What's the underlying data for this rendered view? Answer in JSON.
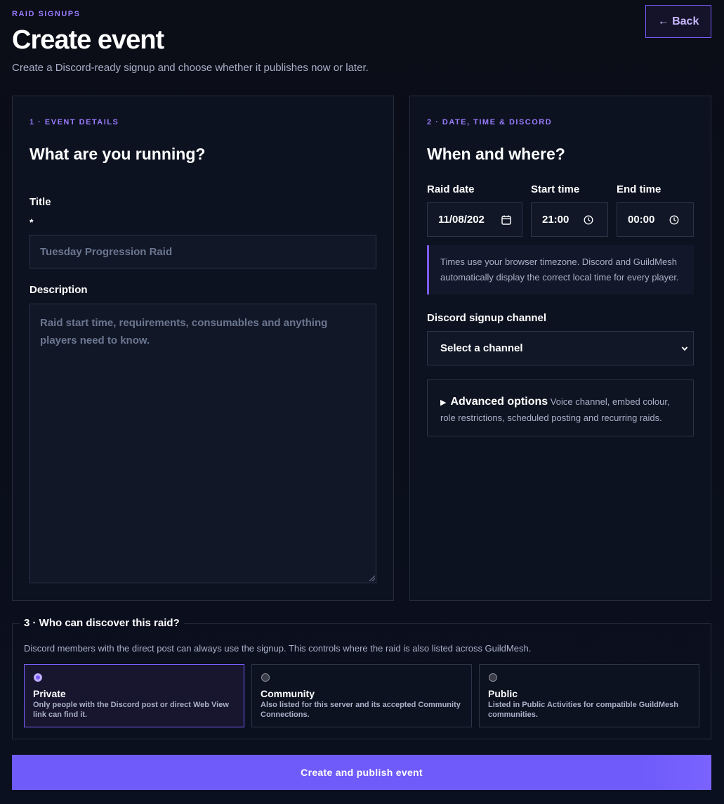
{
  "header": {
    "eyebrow": "RAID SIGNUPS",
    "title": "Create event",
    "subtitle": "Create a Discord-ready signup and choose whether it publishes now or later.",
    "back_label": "← Back"
  },
  "details": {
    "step": "1 · EVENT DETAILS",
    "heading": "What are you running?",
    "title_label": "Title",
    "required_mark": "*",
    "title_placeholder": "Tuesday Progression Raid",
    "title_value": "",
    "description_label": "Description",
    "description_placeholder": "Raid start time, requirements, consumables and anything players need to know.",
    "description_value": ""
  },
  "schedule": {
    "step": "2 · DATE, TIME & DISCORD",
    "heading": "When and where?",
    "date_label": "Raid date",
    "date_value": "11/08/202",
    "start_label": "Start time",
    "start_value": "21:00",
    "end_label": "End time",
    "end_value": "00:00",
    "timezone_note": "Times use your browser timezone. Discord and GuildMesh automatically display the correct local time for every player.",
    "channel_label": "Discord signup channel",
    "channel_value": "Select a channel",
    "advanced_title": "Advanced options",
    "advanced_desc": "Voice channel, embed colour, role restrictions, scheduled posting and recurring raids."
  },
  "visibility": {
    "legend": "3 · Who can discover this raid?",
    "description": "Discord members with the direct post can always use the signup. This controls where the raid is also listed across GuildMesh.",
    "selected": "private",
    "options": [
      {
        "title": "Private",
        "desc": "Only people with the Discord post or direct Web View link can find it."
      },
      {
        "title": "Community",
        "desc": "Also listed for this server and its accepted Community Connections."
      },
      {
        "title": "Public",
        "desc": "Listed in Public Activities for compatible GuildMesh communities."
      }
    ]
  },
  "submit_label": "Create and publish event",
  "colors": {
    "accent": "#7a5cff",
    "button": "#6f5bfa",
    "background": "#0b0e19"
  }
}
